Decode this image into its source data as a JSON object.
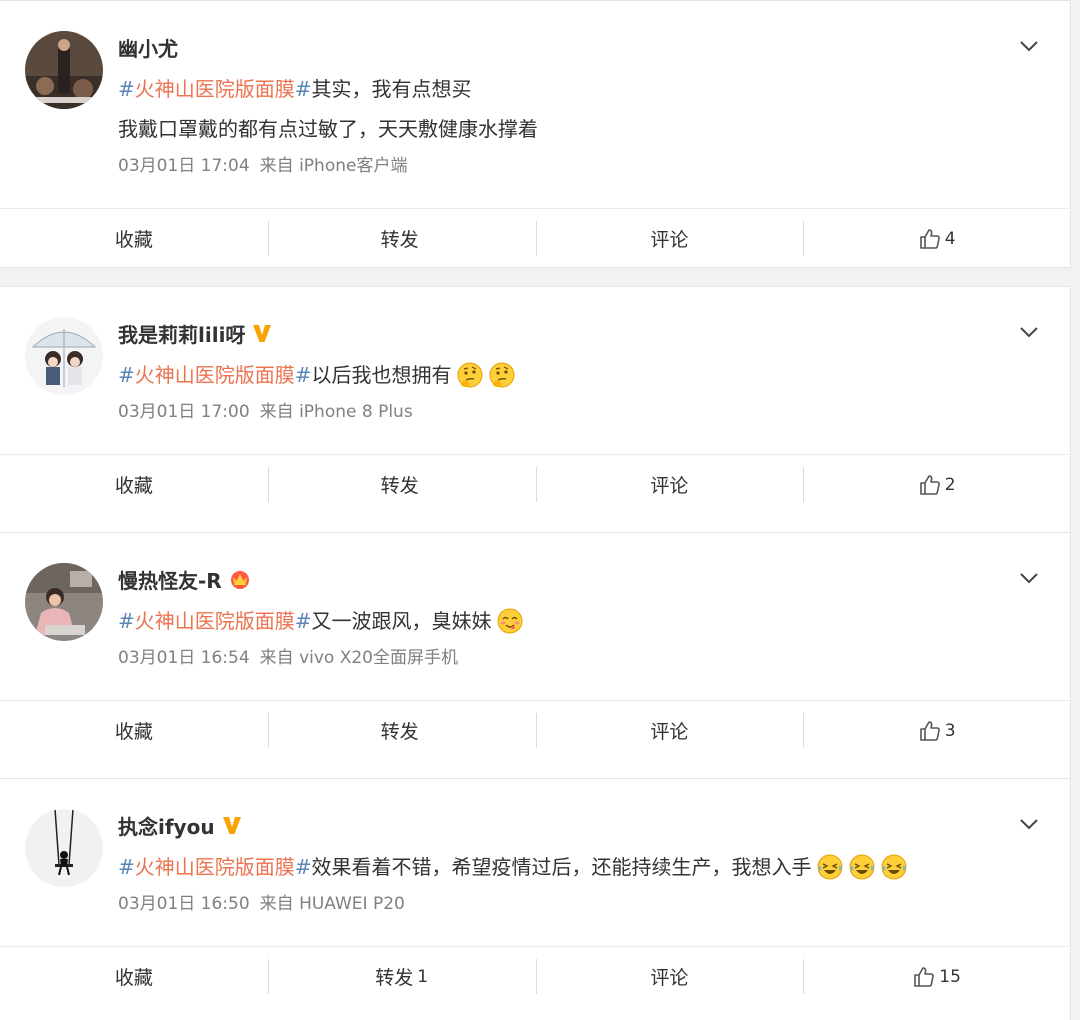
{
  "colors": {
    "hashtag": "#eb7350",
    "hash_mark": "#5b86b8",
    "meta": "#808080",
    "verified": "#f7a400"
  },
  "posts": [
    {
      "username": "幽小尤",
      "badge": null,
      "hashtag_open": "#",
      "hashtag": "火神山医院版面膜",
      "hashtag_close": "#",
      "text": "其实，我有点想买",
      "text_line2": "我戴口罩戴的都有点过敏了，天天敷健康水撑着",
      "emojis": [],
      "time": "03月01日 17:04",
      "source": "来自 iPhone客户端",
      "actions": {
        "favorite": "收藏",
        "repost": "转发",
        "repost_count": "",
        "comment": "评论",
        "like_count": "4"
      }
    },
    {
      "username": "我是莉莉lili呀",
      "badge": "verified-v-icon",
      "hashtag_open": "#",
      "hashtag": "火神山医院版面膜",
      "hashtag_close": "#",
      "text": "以后我也想拥有",
      "emojis": [
        "thinking-emoji",
        "thinking-emoji"
      ],
      "time": "03月01日 17:00",
      "source": "来自 iPhone 8 Plus",
      "actions": {
        "favorite": "收藏",
        "repost": "转发",
        "repost_count": "",
        "comment": "评论",
        "like_count": "2"
      }
    },
    {
      "username": "慢热怪友-R",
      "badge": "crown-badge-icon",
      "hashtag_open": "#",
      "hashtag": "火神山医院版面膜",
      "hashtag_close": "#",
      "text": "又一波跟风，臭妹妹",
      "emojis": [
        "yummy-emoji"
      ],
      "time": "03月01日 16:54",
      "source": "来自 vivo X20全面屏手机",
      "actions": {
        "favorite": "收藏",
        "repost": "转发",
        "repost_count": "",
        "comment": "评论",
        "like_count": "3"
      }
    },
    {
      "username": "执念ifyou",
      "badge": "verified-v-icon",
      "hashtag_open": "#",
      "hashtag": "火神山医院版面膜",
      "hashtag_close": "#",
      "text": "效果看着不错，希望疫情过后，还能持续生产，我想入手",
      "emojis": [
        "laugh-cry-emoji",
        "laugh-cry-emoji",
        "laugh-cry-emoji"
      ],
      "time": "03月01日 16:50",
      "source": "来自 HUAWEI P20",
      "actions": {
        "favorite": "收藏",
        "repost": "转发",
        "repost_count": "1",
        "comment": "评论",
        "like_count": "15"
      }
    }
  ]
}
